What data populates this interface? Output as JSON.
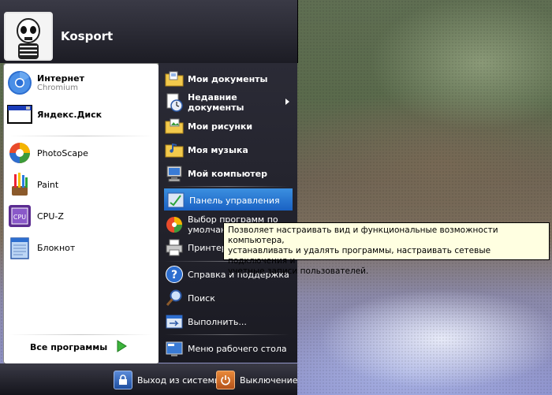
{
  "user": {
    "name": "Kosport"
  },
  "pinned": [
    {
      "title": "Интернет",
      "subtitle": "Chromium",
      "icon": "chromium-icon"
    },
    {
      "title": "Яндекс.Диск",
      "icon": "window-icon"
    }
  ],
  "recent": [
    {
      "label": "PhotoScape",
      "icon": "photoscape-icon"
    },
    {
      "label": "Paint",
      "icon": "paint-brushes-icon"
    },
    {
      "label": "CPU-Z",
      "icon": "cpuz-icon"
    },
    {
      "label": "Блокнот",
      "icon": "notepad-icon"
    }
  ],
  "all_programs": {
    "label": "Все программы",
    "icon": "green-arrow-icon"
  },
  "right": {
    "my_documents": "Мои документы",
    "recent_docs_1": "Недавние",
    "recent_docs_2": "документы",
    "my_pictures": "Мои рисунки",
    "my_music": "Моя музыка",
    "my_computer": "Мой компьютер",
    "control_panel": "Панель управления",
    "default_programs_1": "Выбор программ по",
    "default_programs_2": "умолчанию",
    "printers": "Принтеры и факсы",
    "help": "Справка и поддержка",
    "search": "Поиск",
    "run": "Выполнить...",
    "desktop_menu": "Меню рабочего стола"
  },
  "tooltip": {
    "line1": "Позволяет настраивать вид и функциональные возможности компьютера,",
    "line2": "устанавливать и удалять программы,  настраивать сетевые подключения и",
    "line3": "учетные записи пользователей."
  },
  "footer": {
    "logoff": "Выход из системы",
    "shutdown": "Выключение"
  },
  "colors": {
    "highlight": "#1a62c4",
    "tooltip_bg": "#ffffe1",
    "menu_dark": "#1c1c24"
  }
}
